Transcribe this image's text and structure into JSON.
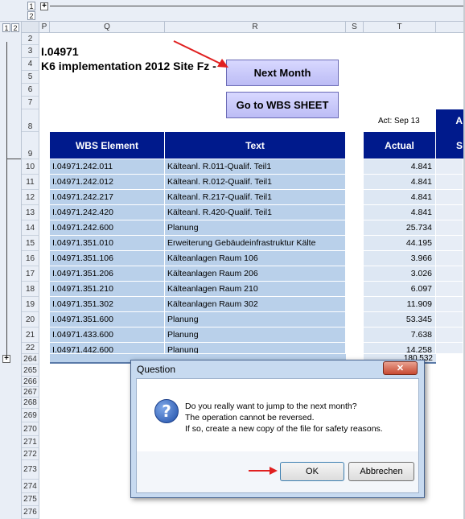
{
  "outline": {
    "col_levels": [
      "1",
      "2"
    ],
    "row_levels": [
      "1",
      "2"
    ],
    "collapsed_symbol": "+",
    "expand_symbol": "+"
  },
  "columns": [
    "P",
    "Q",
    "R",
    "S",
    "T"
  ],
  "rows": [
    "2",
    "3",
    "4",
    "5",
    "6",
    "7",
    "8",
    "9",
    "10",
    "11",
    "12",
    "13",
    "14",
    "15",
    "16",
    "17",
    "18",
    "19",
    "20",
    "21",
    "22",
    "264",
    "265",
    "266",
    "267",
    "268",
    "269",
    "270",
    "271",
    "272",
    "273",
    "274",
    "275",
    "276"
  ],
  "sheet": {
    "title_line1": "I.04971",
    "title_line2": "K6 implementation 2012 Site Fz -",
    "next_month_button": "Next Month",
    "wbs_button": "Go to WBS SHEET",
    "act_label": "Act: Sep 13",
    "right_header_partial": "A",
    "right_sub_partial": "S",
    "headers": {
      "wbs": "WBS Element",
      "text": "Text",
      "actual": "Actual"
    },
    "data_rows": [
      {
        "wbs": "I.04971.242.011",
        "text": "Kälteanl. R.011-Qualif. Teil1",
        "actual": "4.841"
      },
      {
        "wbs": "I.04971.242.012",
        "text": "Kälteanl. R.012-Qualif. Teil1",
        "actual": "4.841"
      },
      {
        "wbs": "I.04971.242.217",
        "text": "Kälteanl. R.217-Qualif. Teil1",
        "actual": "4.841"
      },
      {
        "wbs": "I.04971.242.420",
        "text": "Kälteanl. R.420-Qualif. Teil1",
        "actual": "4.841"
      },
      {
        "wbs": "I.04971.242.600",
        "text": "Planung",
        "actual": "25.734"
      },
      {
        "wbs": "I.04971.351.010",
        "text": "Erweiterung Gebäudeinfrastruktur Kälte",
        "actual": "44.195"
      },
      {
        "wbs": "I.04971.351.106",
        "text": "Kälteanlagen Raum 106",
        "actual": "3.966"
      },
      {
        "wbs": "I.04971.351.206",
        "text": "Kälteanlagen Raum 206",
        "actual": "3.026"
      },
      {
        "wbs": "I.04971.351.210",
        "text": "Kälteanlagen Raum 210",
        "actual": "6.097"
      },
      {
        "wbs": "I.04971.351.302",
        "text": "Kälteanlagen Raum 302",
        "actual": "11.909"
      },
      {
        "wbs": "I.04971.351.600",
        "text": "Planung",
        "actual": "53.345"
      },
      {
        "wbs": "I.04971.433.600",
        "text": "Planung",
        "actual": "7.638"
      },
      {
        "wbs": "I.04971.442.600",
        "text": "Planung",
        "actual": "14.258"
      }
    ],
    "total_partial": "180.532"
  },
  "dialog": {
    "title": "Question",
    "close_symbol": "✕",
    "icon_symbol": "?",
    "message_lines": [
      "Do you really want to jump to the next month?",
      "The operation cannot be reversed.",
      "If so, create a new copy of the file for safety reasons."
    ],
    "ok_label": "OK",
    "cancel_label": "Abbrechen"
  },
  "colors": {
    "header_blue": "#001a8c",
    "cell_blue": "#b9d0ea",
    "arrow_red": "#e02020"
  }
}
